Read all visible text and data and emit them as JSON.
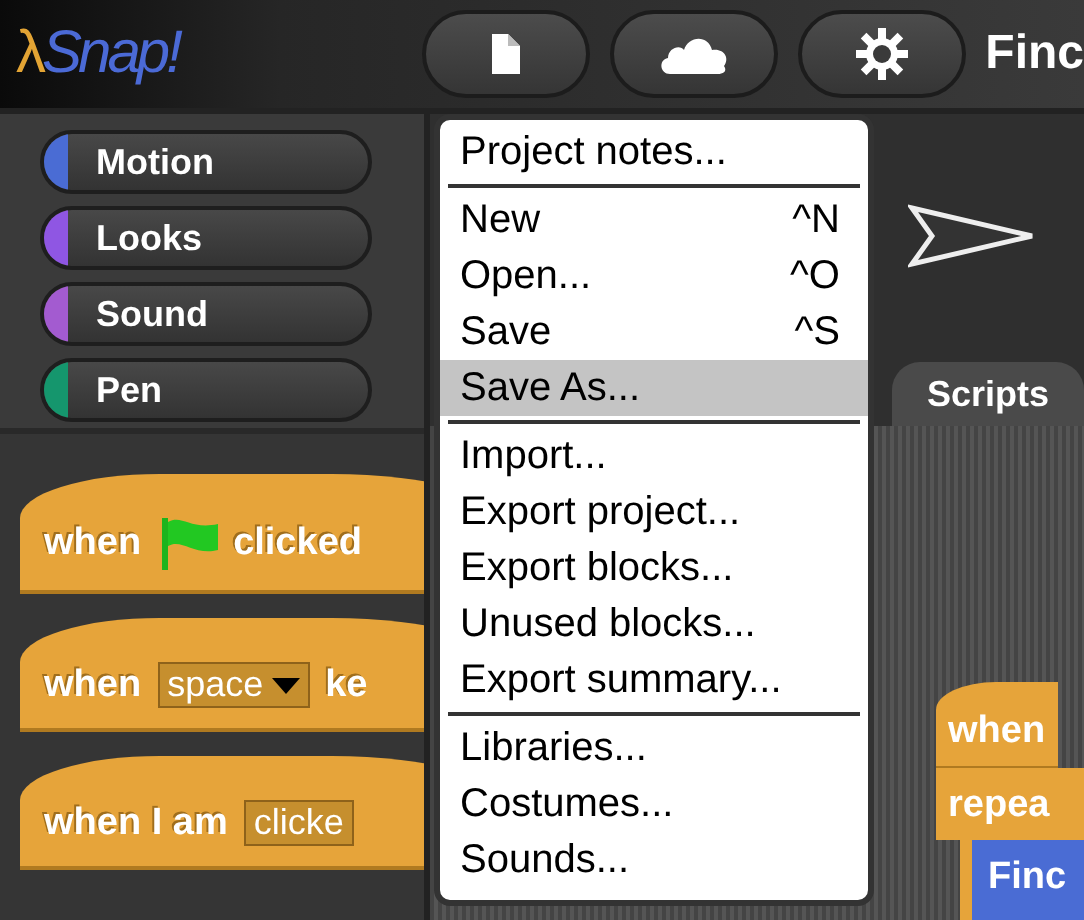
{
  "logo": {
    "symbol": "λ",
    "name": "Snap!"
  },
  "toolbar": [
    {
      "kind": "file"
    },
    {
      "kind": "cloud"
    },
    {
      "kind": "settings"
    }
  ],
  "project_title": "Finc",
  "categories": [
    {
      "label": "Motion",
      "color": "#4a6cd4"
    },
    {
      "label": "Looks",
      "color": "#8f56e3"
    },
    {
      "label": "Sound",
      "color": "#a35bd0"
    },
    {
      "label": "Pen",
      "color": "#15966d"
    }
  ],
  "palette_blocks": [
    {
      "parts": [
        {
          "kind": "text",
          "text": "when"
        },
        {
          "kind": "flag"
        },
        {
          "kind": "text",
          "text": "clicked"
        }
      ]
    },
    {
      "parts": [
        {
          "kind": "text",
          "text": "when"
        },
        {
          "kind": "dropdown",
          "text": "space"
        },
        {
          "kind": "text",
          "text": "ke"
        }
      ]
    },
    {
      "parts": [
        {
          "kind": "text",
          "text": "when I am"
        },
        {
          "kind": "input",
          "text": "clicke"
        }
      ]
    }
  ],
  "file_menu": [
    {
      "kind": "item",
      "label": "Project notes...",
      "selected": false
    },
    {
      "kind": "separator"
    },
    {
      "kind": "item",
      "label": "New",
      "shortcut": "^N",
      "selected": false
    },
    {
      "kind": "item",
      "label": "Open...",
      "shortcut": "^O",
      "selected": false
    },
    {
      "kind": "item",
      "label": "Save",
      "shortcut": "^S",
      "selected": false
    },
    {
      "kind": "item",
      "label": "Save As...",
      "selected": true
    },
    {
      "kind": "separator"
    },
    {
      "kind": "item",
      "label": "Import...",
      "selected": false
    },
    {
      "kind": "item",
      "label": "Export project...",
      "selected": false
    },
    {
      "kind": "item",
      "label": "Export blocks...",
      "selected": false
    },
    {
      "kind": "item",
      "label": "Unused blocks...",
      "selected": false
    },
    {
      "kind": "item",
      "label": "Export summary...",
      "selected": false
    },
    {
      "kind": "separator"
    },
    {
      "kind": "item",
      "label": "Libraries...",
      "selected": false
    },
    {
      "kind": "item",
      "label": "Costumes...",
      "selected": false
    },
    {
      "kind": "item",
      "label": "Sounds...",
      "selected": false
    }
  ],
  "tabs": [
    {
      "label": "Scripts",
      "selected": true
    }
  ],
  "script_blocks": [
    {
      "kind": "hat",
      "text": "when"
    },
    {
      "kind": "control",
      "text": "repea"
    },
    {
      "kind": "motion",
      "text": "Finc"
    }
  ]
}
